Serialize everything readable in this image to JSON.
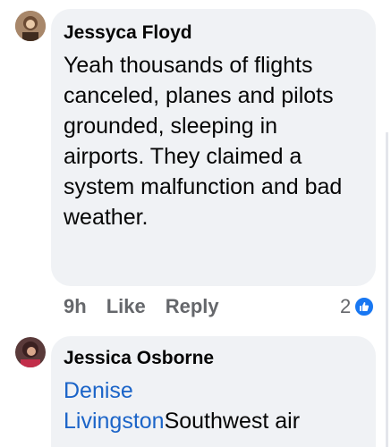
{
  "comments": [
    {
      "author": "Jessyca Floyd",
      "text": "Yeah thousands of flights canceled, planes and pilots grounded, sleeping in airports. They claimed a system malfunction and bad weather.",
      "time": "9h",
      "like_label": "Like",
      "reply_label": "Reply",
      "reaction_count": "2",
      "reaction_icon": "like-icon"
    },
    {
      "author": "Jessica Osborne",
      "mention": "Denise Livingston",
      "text": "Southwest air"
    }
  ],
  "colors": {
    "bubble": "#f0f2f5",
    "mention": "#1b64c8",
    "muted": "#65676b",
    "like_badge": "#1877f2"
  }
}
